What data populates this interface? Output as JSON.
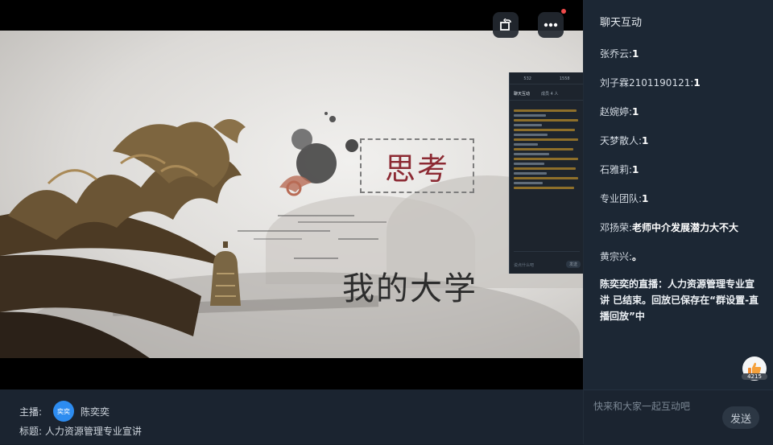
{
  "inset": {
    "stat_left": "532",
    "stat_right": "1558",
    "tab_chat": "聊天互动",
    "tab_other": "成员 4 人",
    "input_placeholder": "说点什么吧",
    "send_label": "发送"
  },
  "slide": {
    "think_label": "思考",
    "title": "我的大学"
  },
  "info": {
    "host_label": "主播:",
    "host_avatar_text": "奕奕",
    "host_name": "陈奕奕",
    "title_label": "标题:",
    "title_value": "人力资源管理专业宣讲"
  },
  "chat": {
    "header": "聊天互动",
    "messages": [
      {
        "user": "张乔云:",
        "text": "1"
      },
      {
        "user": "刘子霖2101190121:",
        "text": "1"
      },
      {
        "user": "赵婉婷:",
        "text": "1"
      },
      {
        "user": "天梦散人:",
        "text": "1"
      },
      {
        "user": "石雅莉:",
        "text": "1"
      },
      {
        "user": "专业团队:",
        "text": "1"
      },
      {
        "user": "邓扬荣:",
        "text": "老师中介发展潜力大不大"
      },
      {
        "user": "黄宗兴:",
        "text": "。"
      }
    ],
    "system_message": "陈奕奕的直播：人力资源管理专业宣讲 已结束。回放已保存在“群设置-直播回放”中",
    "like_count": "4215",
    "input_placeholder": "快来和大家一起互动吧",
    "send_label": "发送"
  },
  "icons": {
    "rotate": "rotate-screen-icon",
    "more": "more-dots-icon",
    "like": "thumbs-up-icon"
  },
  "colors": {
    "panel_bg": "#1c2734",
    "accent_avatar": "#2d8cf0",
    "think_text": "#8c2a33",
    "notification_dot": "#f04b4b"
  }
}
